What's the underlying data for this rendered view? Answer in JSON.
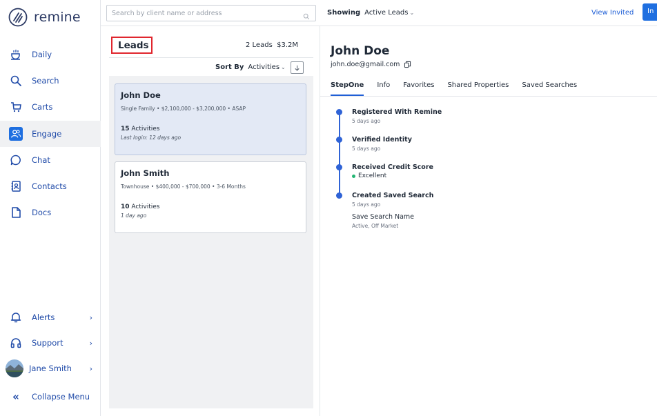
{
  "app": {
    "name": "remine"
  },
  "sidebar": {
    "nav": [
      {
        "label": "Daily",
        "icon": "coffee-cup-icon"
      },
      {
        "label": "Search",
        "icon": "search-icon"
      },
      {
        "label": "Carts",
        "icon": "cart-icon"
      },
      {
        "label": "Engage",
        "icon": "people-icon",
        "active": true
      },
      {
        "label": "Chat",
        "icon": "chat-bubble-icon"
      },
      {
        "label": "Contacts",
        "icon": "contact-book-icon"
      },
      {
        "label": "Docs",
        "icon": "document-icon"
      }
    ],
    "bottom": {
      "alerts": "Alerts",
      "support": "Support",
      "user": "Jane Smith",
      "collapse": "Collapse Menu"
    }
  },
  "topbar": {
    "search_placeholder": "Search by client name or address",
    "showing_label": "Showing",
    "showing_value": "Active Leads",
    "view_invited": "View Invited",
    "invite_button": "In"
  },
  "leads": {
    "title": "Leads",
    "count": "2 Leads  $3.2M",
    "sort_label": "Sort By",
    "sort_value": "Activities",
    "cards": [
      {
        "name": "John Doe",
        "meta": "Single Family • $2,100,000 - $3,200,000 • ASAP",
        "activities_count": "15",
        "activities_label": " Activities",
        "last": "Last login: 12 days ago",
        "selected": true
      },
      {
        "name": "John Smith",
        "meta": "Townhouse • $400,000 - $700,000 • 3-6 Months",
        "activities_count": "10",
        "activities_label": " Activities",
        "last": "1 day ago",
        "selected": false
      }
    ]
  },
  "detail": {
    "name": "John Doe",
    "email": "john.doe@gmail.com",
    "tabs": [
      "StepOne",
      "Info",
      "Favorites",
      "Shared Properties",
      "Saved Searches"
    ],
    "timeline": [
      {
        "title": "Registered With Remine",
        "sub": "5 days ago"
      },
      {
        "title": "Verified Identity",
        "sub": "5 days ago"
      },
      {
        "title": "Received Credit Score",
        "score": "Excellent"
      },
      {
        "title": "Created Saved Search",
        "sub": "5 days ago",
        "extra_title": "Save Search Name",
        "extra_sub": "Active, Off Market"
      }
    ]
  },
  "colors": {
    "accent": "#1f5fd6",
    "nav_text": "#1f4aa8",
    "highlight": "#e0262e",
    "score_good": "#22b573"
  }
}
